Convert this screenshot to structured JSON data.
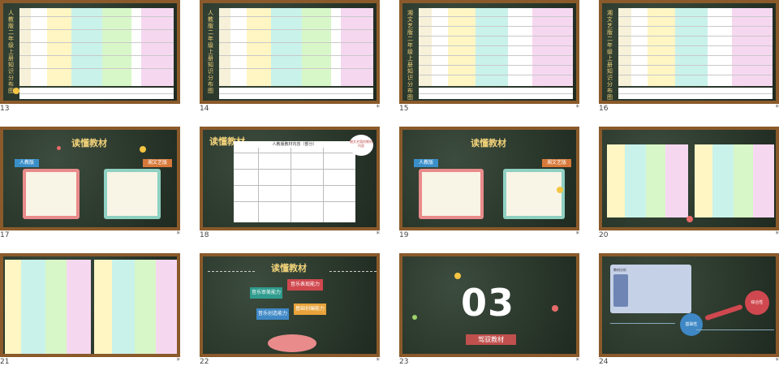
{
  "slides": [
    {
      "number": "13",
      "star": "",
      "title": "人教版二年级上册知识分布图"
    },
    {
      "number": "14",
      "star": "*",
      "title": "人教版二年级上册知识分布图"
    },
    {
      "number": "15",
      "star": "*",
      "title": "湘文艺版二年级上册知识分布图"
    },
    {
      "number": "16",
      "star": "*",
      "title": "湘文艺版二年级上册知识分布图"
    },
    {
      "number": "17",
      "star": "*",
      "title": "读懂教材",
      "left_tag": "人教版",
      "right_tag": "湘文艺版"
    },
    {
      "number": "18",
      "star": "*",
      "title": "读懂教材",
      "sub_title": "人教版教材内容（部分）",
      "bubble": "湘文艺版的教材内容"
    },
    {
      "number": "19",
      "star": "*",
      "title": "读懂教材",
      "left_tag": "人教版",
      "right_tag": "湘文艺版"
    },
    {
      "number": "20",
      "star": "*"
    },
    {
      "number": "21",
      "star": "*"
    },
    {
      "number": "22",
      "star": "*",
      "title": "读懂教材",
      "bubbles": [
        "音乐审美能力",
        "音乐表现能力",
        "音乐创造能力",
        "基础创编能力"
      ]
    },
    {
      "number": "23",
      "star": "*",
      "big_number": "03",
      "tag": "驾驭教材"
    },
    {
      "number": "24",
      "star": "*",
      "label": "教材分析",
      "pill_1": "基础性",
      "pill_2": "综合性"
    }
  ],
  "colors": {
    "frame": "#8a5a2b",
    "chalk": "#2c3a2e",
    "accent_yellow": "#f2d27a",
    "accent_red": "#c0504d"
  }
}
